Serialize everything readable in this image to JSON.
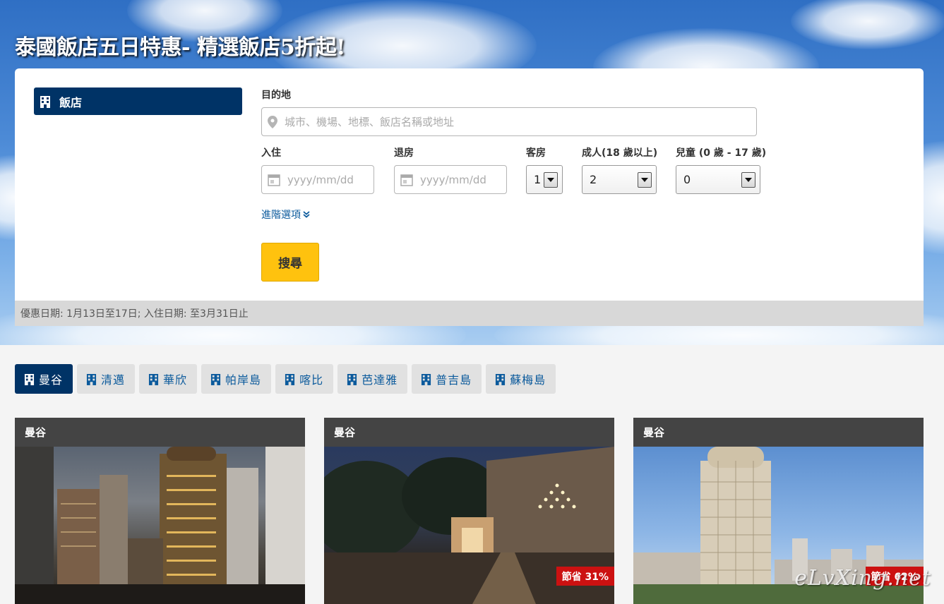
{
  "hero": {
    "title": "泰國飯店五日特惠- 精選飯店5折起!"
  },
  "search": {
    "tab_label": "飯店",
    "destination_label": "目的地",
    "destination_placeholder": "城市、機場、地標、飯店名稱或地址",
    "checkin_label": "入住",
    "checkout_label": "退房",
    "date_placeholder": "yyyy/mm/dd",
    "rooms_label": "客房",
    "rooms_value": "1",
    "adults_label": "成人(18 歲以上)",
    "adults_value": "2",
    "children_label": "兒童 (0 歲 - 17 歲)",
    "children_value": "0",
    "advanced_label": "進階選項",
    "search_button": "搜尋",
    "promo_text": "優惠日期: 1月13日至17日; 入住日期: 至3月31日止"
  },
  "city_tabs": [
    {
      "label": "曼谷",
      "active": true
    },
    {
      "label": "清邁",
      "active": false
    },
    {
      "label": "華欣",
      "active": false
    },
    {
      "label": "帕岸島",
      "active": false
    },
    {
      "label": "喀比",
      "active": false
    },
    {
      "label": "芭達雅",
      "active": false
    },
    {
      "label": "普吉島",
      "active": false
    },
    {
      "label": "蘇梅島",
      "active": false
    }
  ],
  "cards": [
    {
      "city": "曼谷",
      "badge": ""
    },
    {
      "city": "曼谷",
      "badge": "節省 31%"
    },
    {
      "city": "曼谷",
      "badge": "節省 62%"
    }
  ],
  "watermark": "eLvXing.net",
  "colors": {
    "primary": "#003366",
    "accent": "#ffc20e",
    "link": "#0b5a9c",
    "badge": "#cc1111"
  }
}
